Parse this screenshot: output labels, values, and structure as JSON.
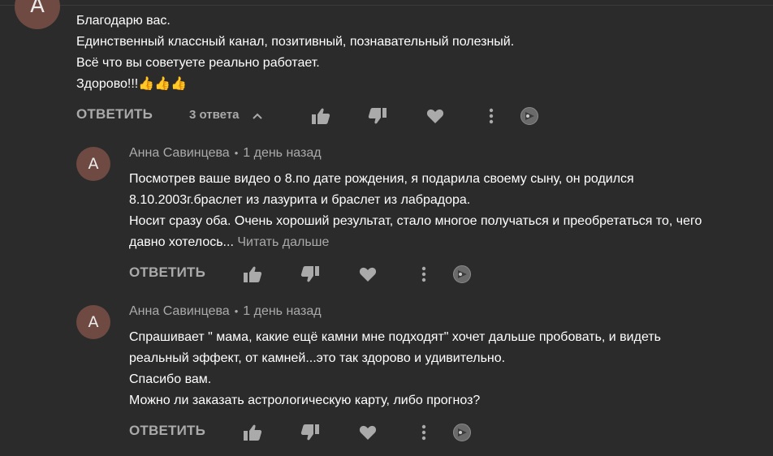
{
  "top_comment": {
    "avatar_letter": "А",
    "lines": [
      "Благодарю вас.",
      "Единственный классный канал, позитивный, познавательный полезный.",
      "Всё что вы советуете реально работает.",
      "Здорово!!!👍👍👍"
    ],
    "reply_label": "ОТВЕТИТЬ",
    "replies_label": "3 ответа"
  },
  "replies": [
    {
      "avatar_letter": "А",
      "author": "Анна Савинцева",
      "separator": "•",
      "time": "1 день назад",
      "lines": [
        "Посмотрев ваше видео о 8.по дате рождения, я подарила своему сыну, он родился",
        "8.10.2003г.браслет из лазурита и браслет из лабрадора.",
        "Носит сразу оба. Очень хороший результат, стало многое получаться и преобретаться то, чего",
        "давно хотелось..."
      ],
      "read_more": "Читать дальше",
      "reply_label": "ОТВЕТИТЬ"
    },
    {
      "avatar_letter": "А",
      "author": "Анна Савинцева",
      "separator": "•",
      "time": "1 день назад",
      "lines": [
        "Спрашивает \" мама, какие ещё камни мне подходят\" хочет дальше пробовать, и видеть",
        "реальный эффект, от камней...это так здорово и удивительно.",
        "Спасибо вам.",
        "Можно ли заказать астрологическую карту, либо прогноз?"
      ],
      "reply_label": "ОТВЕТИТЬ"
    }
  ],
  "icons": [
    "thumbs-up-icon",
    "thumbs-down-icon",
    "heart-icon",
    "more-vert-icon",
    "reaction-badge-icon",
    "chevron-up-icon"
  ],
  "colors": {
    "background": "#2b2b2b",
    "text": "#ffffff",
    "secondary": "#aaaaaa",
    "avatar": "#6e4a42"
  }
}
